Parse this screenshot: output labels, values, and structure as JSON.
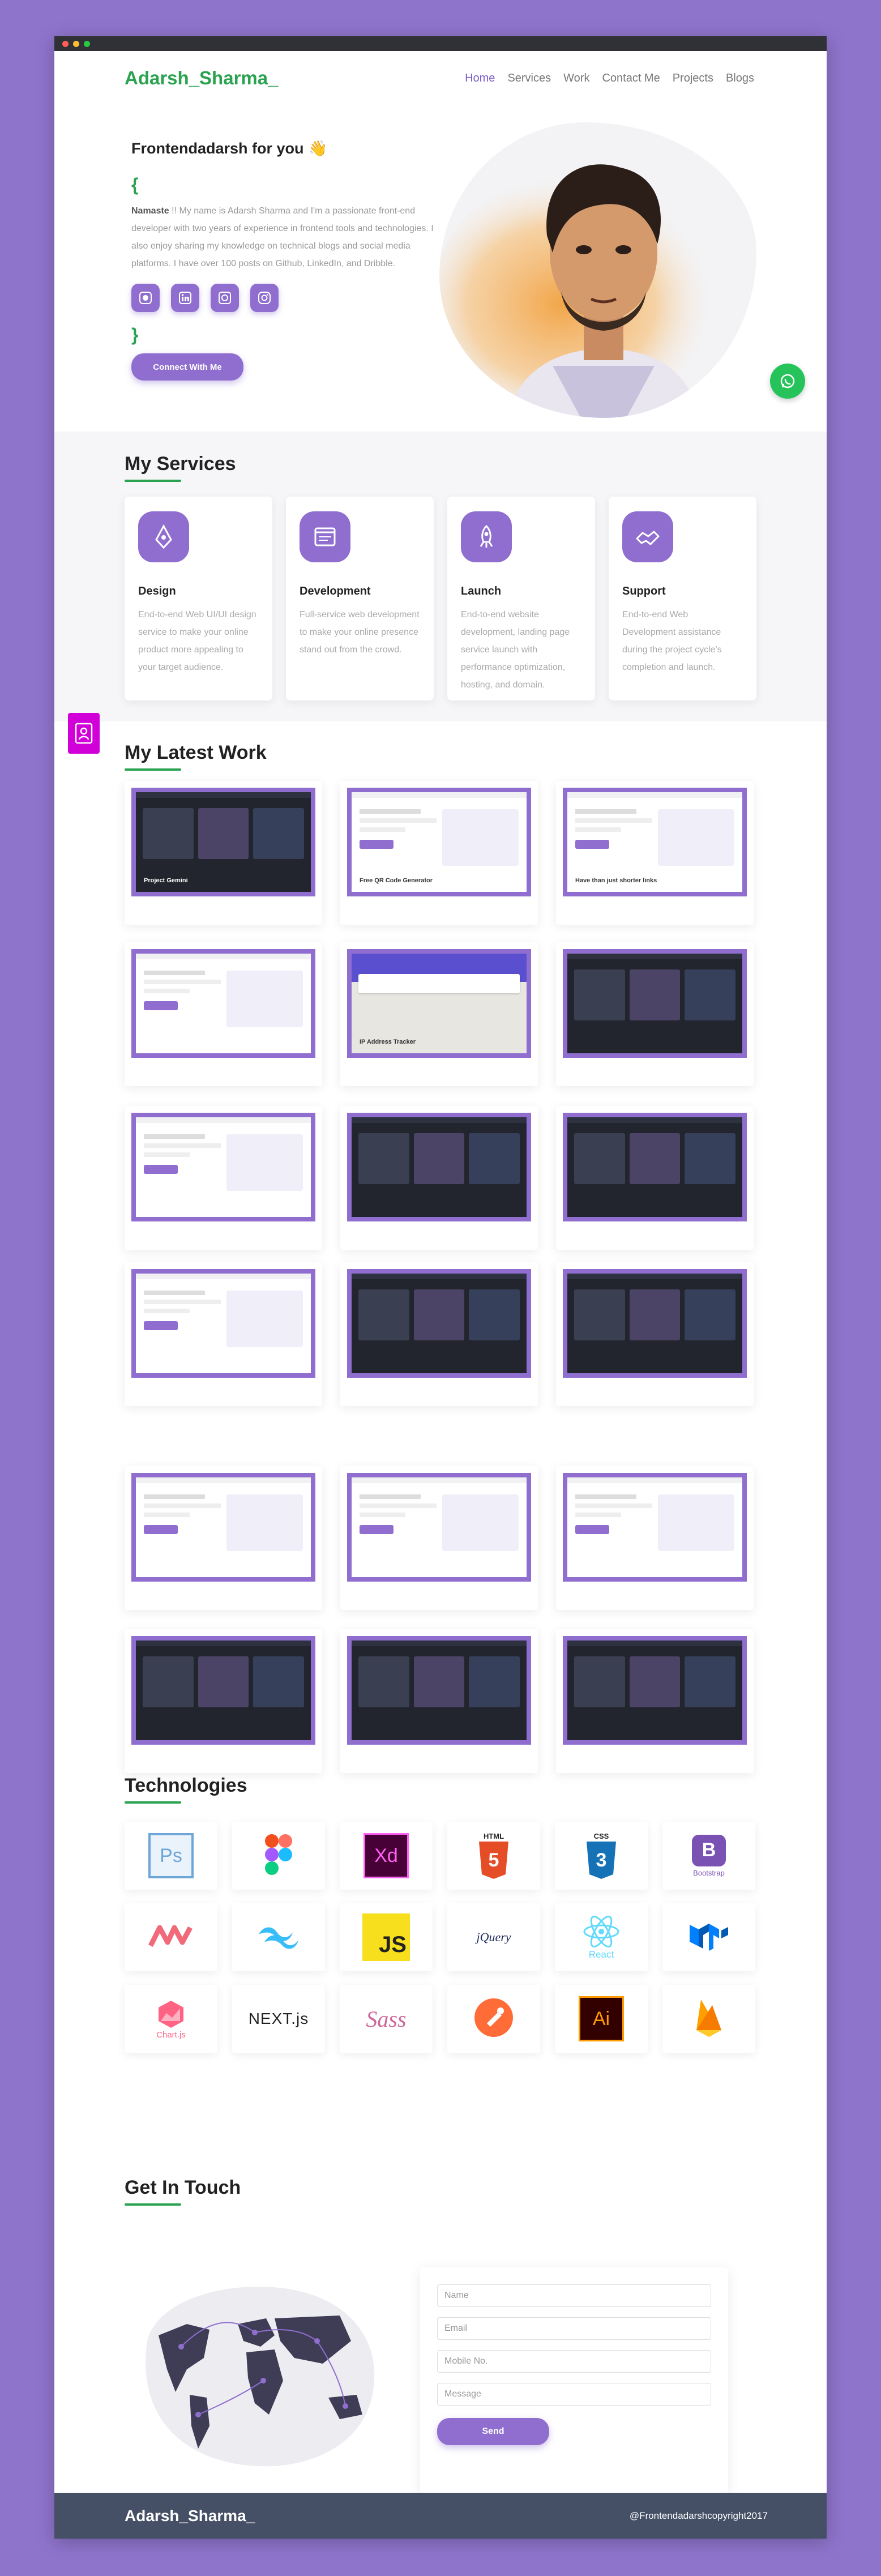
{
  "nav": {
    "logo": "Adarsh_Sharma_",
    "links": [
      "Home",
      "Services",
      "Work",
      "Contact Me",
      "Projects",
      "Blogs"
    ]
  },
  "hero": {
    "title": "Frontendadarsh for you",
    "wave_emoji": "👋",
    "open_brace": "{",
    "close_brace": "}",
    "intro_bold": "Namaste",
    "intro": " !! My name is Adarsh Sharma and I'm a passionate front-end developer with two years of experience in frontend tools and technologies. I also enjoy sharing my knowledge on technical blogs and social media platforms. I have over 100 posts on Github, LinkedIn, and Dribble.",
    "social_icons": [
      "github-icon",
      "linkedin-icon",
      "dribbble-icon",
      "instagram-icon"
    ],
    "connect_label": "Connect With Me"
  },
  "services": {
    "title": "My Services",
    "items": [
      {
        "title": "Design",
        "text": "End-to-end Web UI/UI design service to make your online product more appealing to your target audience."
      },
      {
        "title": "Development",
        "text": "Full-service web development to make your online presence stand out from the crowd."
      },
      {
        "title": "Launch",
        "text": "End-to-end website development, landing page service launch with performance optimization, hosting, and domain."
      },
      {
        "title": "Support",
        "text": "End-to-end Web Development assistance during the project cycle's completion and launch."
      }
    ]
  },
  "work": {
    "title": "My Latest Work",
    "thumbs": [
      {
        "theme": "dark",
        "caption": "Project Gemini"
      },
      {
        "theme": "light",
        "caption": "Free QR Code Generator"
      },
      {
        "theme": "light",
        "caption": "Have than just shorter links"
      },
      {
        "theme": "light",
        "caption": ""
      },
      {
        "theme": "map",
        "caption": "IP Address Tracker"
      },
      {
        "theme": "dark",
        "caption": ""
      },
      {
        "theme": "light",
        "caption": ""
      },
      {
        "theme": "dark",
        "caption": ""
      },
      {
        "theme": "dark",
        "caption": ""
      },
      {
        "theme": "light",
        "caption": ""
      },
      {
        "theme": "dark",
        "caption": ""
      },
      {
        "theme": "dark",
        "caption": ""
      },
      {
        "theme": "light",
        "caption": ""
      },
      {
        "theme": "light",
        "caption": ""
      },
      {
        "theme": "light",
        "caption": ""
      },
      {
        "theme": "dark",
        "caption": ""
      },
      {
        "theme": "dark",
        "caption": ""
      },
      {
        "theme": "dark",
        "caption": ""
      }
    ]
  },
  "technologies": {
    "title": "Technologies",
    "items": [
      {
        "icon": "photoshop-icon",
        "label": "Ps"
      },
      {
        "icon": "figma-icon",
        "label": ""
      },
      {
        "icon": "xd-icon",
        "label": "Xd"
      },
      {
        "icon": "html5-icon",
        "label": "HTML"
      },
      {
        "icon": "css3-icon",
        "label": "CSS"
      },
      {
        "icon": "bootstrap-icon",
        "label": "Bootstrap"
      },
      {
        "icon": "material-icon",
        "label": ""
      },
      {
        "icon": "tailwind-icon",
        "label": ""
      },
      {
        "icon": "javascript-icon",
        "label": "JS"
      },
      {
        "icon": "jquery-icon",
        "label": "jQuery"
      },
      {
        "icon": "react-icon",
        "label": "React"
      },
      {
        "icon": "mui-icon",
        "label": ""
      },
      {
        "icon": "chartjs-icon",
        "label": "Chart.js"
      },
      {
        "icon": "nextjs-icon",
        "label": "NEXT.js"
      },
      {
        "icon": "sass-icon",
        "label": "Sass"
      },
      {
        "icon": "postman-icon",
        "label": ""
      },
      {
        "icon": "illustrator-icon",
        "label": "Ai"
      },
      {
        "icon": "firebase-icon",
        "label": ""
      }
    ]
  },
  "contact": {
    "title": "Get In Touch",
    "fields": [
      {
        "name": "name",
        "placeholder": "Name"
      },
      {
        "name": "email",
        "placeholder": "Email"
      },
      {
        "name": "mobile",
        "placeholder": "Mobile No."
      },
      {
        "name": "message",
        "placeholder": "Message"
      }
    ],
    "send_label": "Send"
  },
  "footer": {
    "logo": "Adarsh_Sharma_",
    "copyright": "@Frontendadarshcopyright2017"
  },
  "colors": {
    "accent": "#8f6ecf",
    "green": "#2aa24f",
    "background": "#8f74cc",
    "footer": "#455066"
  }
}
